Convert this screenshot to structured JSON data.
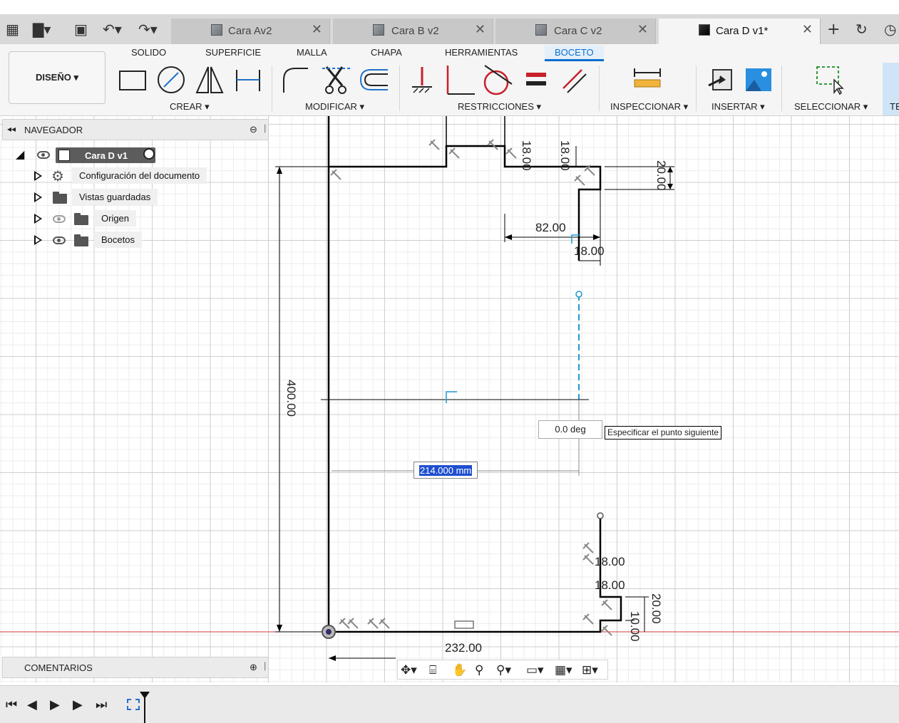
{
  "quick_access": {
    "grid": "grid-icon",
    "file": "file-icon",
    "save": "save-icon",
    "undo": "undo-icon",
    "redo": "redo-icon"
  },
  "tabs": [
    {
      "label": "Cara Av2",
      "active": false
    },
    {
      "label": "Cara B v2",
      "active": false
    },
    {
      "label": "Cara C v2",
      "active": false
    },
    {
      "label": "Cara D v1*",
      "active": true
    }
  ],
  "ribbon_tabs": [
    "SOLIDO",
    "SUPERFICIE",
    "MALLA",
    "CHAPA",
    "HERRAMIENTAS",
    "BOCETO"
  ],
  "design_button": "DISEÑO ▾",
  "groups": {
    "crear": "CREAR ▾",
    "modificar": "MODIFICAR ▾",
    "restricciones": "RESTRICCIONES ▾",
    "inspeccionar": "INSPECCIONAR ▾",
    "insertar": "INSERTAR ▾",
    "seleccionar": "SELECCIONAR ▾",
    "extra": "TE"
  },
  "navigator": {
    "title": "NAVEGADOR",
    "root": "Cara D v1",
    "items": [
      {
        "label": "Configuración del documento",
        "icon": "gear-icon"
      },
      {
        "label": "Vistas guardadas",
        "icon": "folder-icon"
      },
      {
        "label": "Origen",
        "icon": "folder-icon"
      },
      {
        "label": "Bocetos",
        "icon": "folder-icon"
      }
    ]
  },
  "comments": "COMENTARIOS",
  "sketch": {
    "dims": {
      "d400": "400.00",
      "d232": "232.00",
      "d82": "82.00",
      "d18a": "18.00",
      "d18b": "18.00",
      "d18c": "18.00",
      "d18d": "18.00",
      "d18e": "18.00",
      "d20a": "20.00",
      "d20b": "20.00",
      "d10": "10.00"
    },
    "angle": "0.0 deg",
    "tooltip": "Especificar el punto siguiente",
    "length_input": "214.000 mm"
  },
  "colors": {
    "accent": "#0a6ed1",
    "sketch_line": "#000000",
    "construction": "#1e9ad6",
    "axis_red": "#d93a3a"
  }
}
